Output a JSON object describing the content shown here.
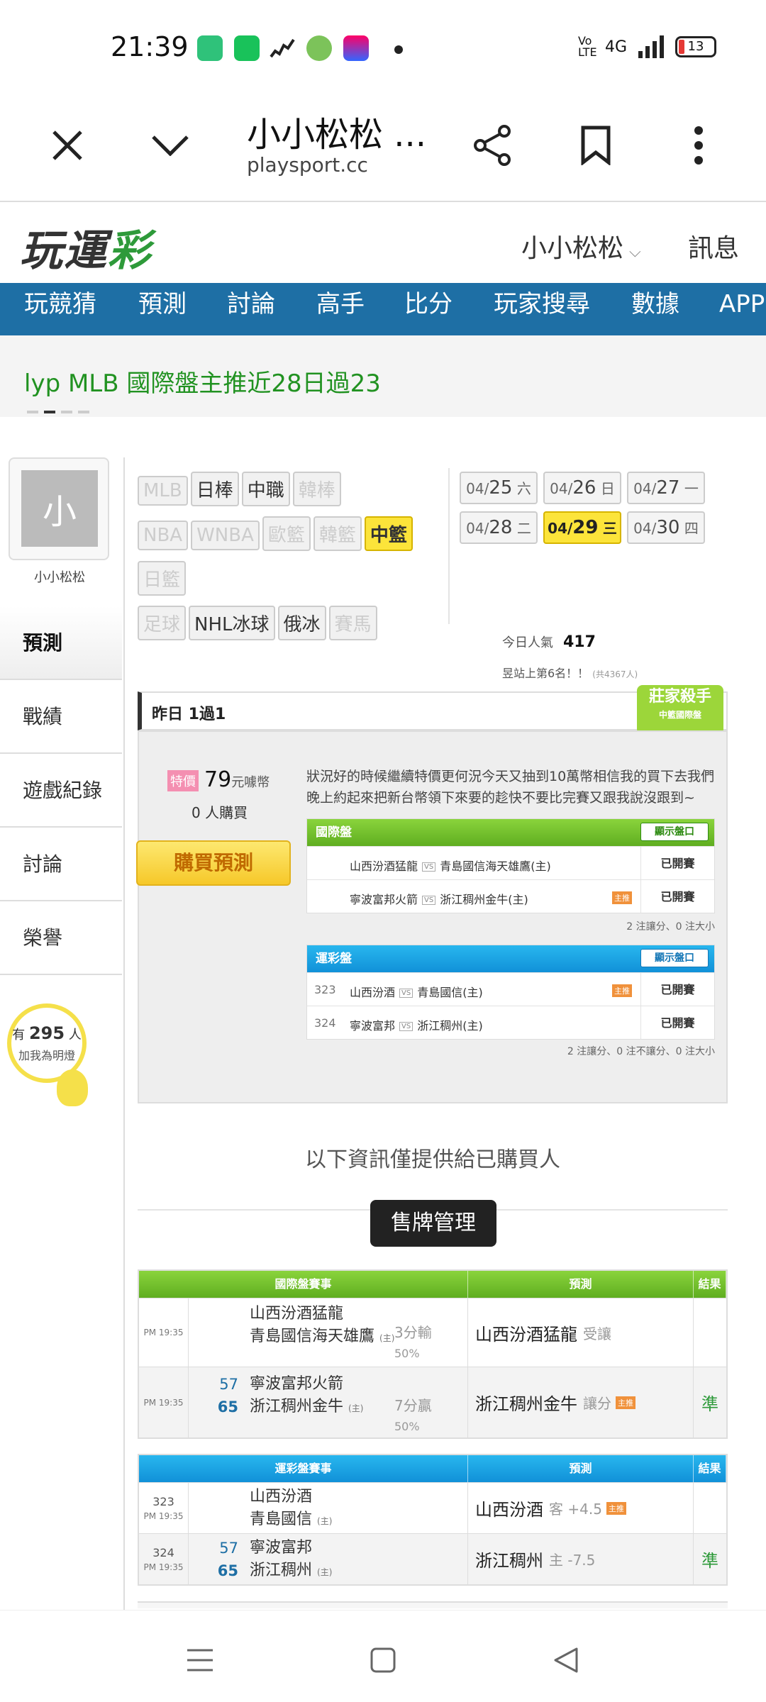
{
  "status_bar": {
    "time": "21:39",
    "network": "4G",
    "volte": "Vo LTE",
    "battery": "13"
  },
  "browser": {
    "title": "小小松松 ...",
    "url": "playsport.cc"
  },
  "site": {
    "logo_a": "玩運",
    "logo_b": "彩",
    "user": "小小松松",
    "messages": "訊息"
  },
  "nav": [
    "玩競猜",
    "預測",
    "討論",
    "高手",
    "比分",
    "玩家搜尋",
    "數據",
    "APP"
  ],
  "ticker": "lyp MLB 國際盤主推近28日過23",
  "profile": {
    "avatar_char": "小",
    "name": "小小松松",
    "menu": [
      "預測",
      "戰績",
      "遊戲紀錄",
      "討論",
      "榮譽"
    ],
    "fans_prefix": "有",
    "fans_count": "295",
    "fans_suffix": "人",
    "fans_cta": "加我為明燈"
  },
  "leagues": {
    "row1": [
      "MLB",
      "日棒",
      "中職",
      "韓棒"
    ],
    "row2": [
      "NBA",
      "WNBA",
      "歐籃",
      "韓籃",
      "中籃"
    ],
    "row3": [
      "日籃"
    ],
    "row4": [
      "足球",
      "NHL冰球",
      "俄冰",
      "賽馬"
    ]
  },
  "dates": [
    {
      "md": "04/",
      "d": "25",
      "w": "六"
    },
    {
      "md": "04/",
      "d": "26",
      "w": "日"
    },
    {
      "md": "04/",
      "d": "27",
      "w": "一"
    },
    {
      "md": "04/",
      "d": "28",
      "w": "二"
    },
    {
      "md": "04/",
      "d": "29",
      "w": "三"
    },
    {
      "md": "04/",
      "d": "30",
      "w": "四"
    }
  ],
  "popularity": {
    "label": "今日人氣",
    "value": "417",
    "rank": "昱站上第6名！！",
    "rank_total": "(共4367人)"
  },
  "yesterday": "昨日 1過1",
  "badge": {
    "title": "莊家殺手",
    "sub": "中籃國際盤"
  },
  "purchase": {
    "tag": "特價",
    "price": "79",
    "unit": "元噱幣",
    "buyers_count": "0",
    "buyers_label": "人購買",
    "button": "購買預測",
    "description": "狀況好的時候繼續特價更何況今天又抽到10萬幣相信我的買下去我們晚上約起來把新台幣領下來要的趁快不要比完賽又跟我說沒跟到~"
  },
  "intl_table": {
    "title": "國際盤",
    "show": "顯示盤口",
    "rows": [
      {
        "home": "山西汾酒猛龍",
        "away": "青島國信海天雄鷹(主)",
        "status": "已開賽"
      },
      {
        "home": "寧波富邦火箭",
        "away": "浙江稠州金牛(主)",
        "host": "主推",
        "status": "已開賽"
      }
    ],
    "note": "2 注讓分、0 注大小"
  },
  "lottery_table": {
    "title": "運彩盤",
    "show": "顯示盤口",
    "rows": [
      {
        "num": "323",
        "home": "山西汾酒",
        "away": "青島國信(主)",
        "host": "主推",
        "status": "已開賽"
      },
      {
        "num": "324",
        "home": "寧波富邦",
        "away": "浙江稠州(主)",
        "status": "已開賽"
      }
    ],
    "note": "2 注讓分、0 注不讓分、0 注大小"
  },
  "info_text": "以下資訊僅提供給已購買人",
  "sell_button": "售牌管理",
  "intl_games": {
    "headers": [
      "國際盤賽事",
      "預測",
      "結果"
    ],
    "rows": [
      {
        "time": "PM 19:35",
        "team1": "山西汾酒猛龍",
        "team2": "青島國信海天雄鷹",
        "home": "(主)",
        "score1": "",
        "score2": "",
        "result": "3分輸",
        "pct": "50%",
        "pick": "山西汾酒猛龍",
        "pick_type": "受讓",
        "host": "",
        "outcome": ""
      },
      {
        "time": "PM 19:35",
        "team1": "寧波富邦火箭",
        "team2": "浙江稠州金牛",
        "home": "(主)",
        "score1": "57",
        "score2": "65",
        "result": "7分贏",
        "pct": "50%",
        "pick": "浙江稠州金牛",
        "pick_type": "讓分",
        "host": "主推",
        "outcome": "準"
      }
    ]
  },
  "lottery_games": {
    "headers": [
      "運彩盤賽事",
      "預測",
      "結果"
    ],
    "rows": [
      {
        "code": "323",
        "time": "PM 19:35",
        "team1": "山西汾酒",
        "team2": "青島國信",
        "home": "(主)",
        "score1": "",
        "score2": "",
        "pick": "山西汾酒",
        "pick_type": "客 +4.5",
        "host": "主推",
        "outcome": ""
      },
      {
        "code": "324",
        "time": "PM 19:35",
        "team1": "寧波富邦",
        "team2": "浙江稠州",
        "home": "(主)",
        "score1": "57",
        "score2": "65",
        "pick": "浙江稠州",
        "pick_type": "主 -7.5",
        "host": "",
        "outcome": "準"
      }
    ]
  }
}
